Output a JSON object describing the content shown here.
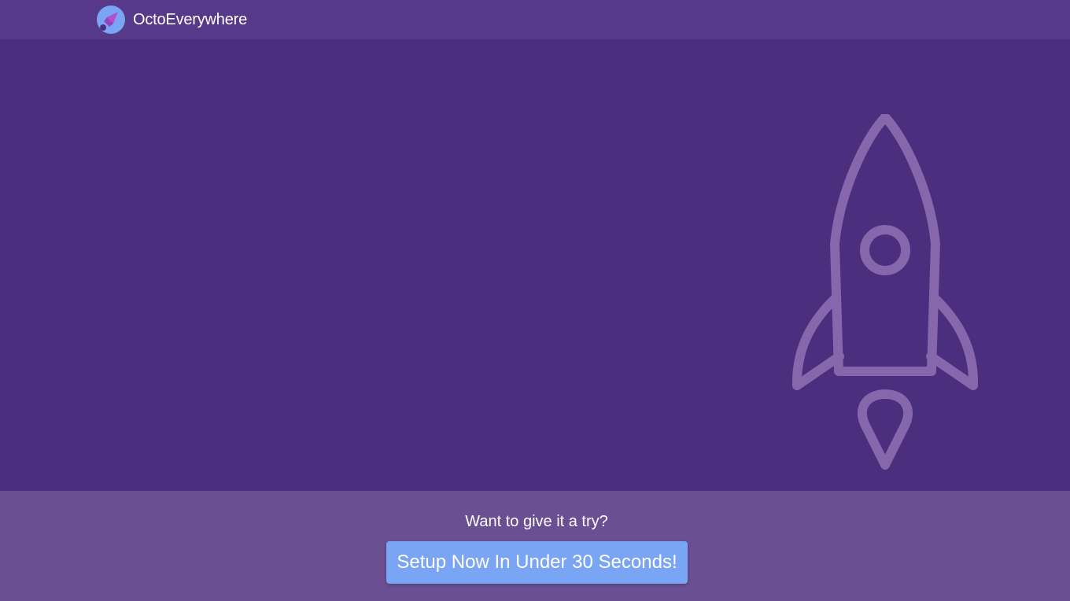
{
  "header": {
    "brand_name": "OctoEverywhere",
    "logo_icon": "rocket-logo-icon"
  },
  "hero": {
    "illustration_icon": "rocket-outline-icon"
  },
  "cta": {
    "prompt": "Want to give it a try?",
    "button_label": "Setup Now In Under 30 Seconds!"
  },
  "colors": {
    "header_bg": "#563a89",
    "hero_bg": "#4b2e7d",
    "cta_bg": "#6a4f93",
    "button_bg": "#7aa5f4",
    "rocket_stroke": "#8667ac",
    "text": "#ffffff"
  }
}
